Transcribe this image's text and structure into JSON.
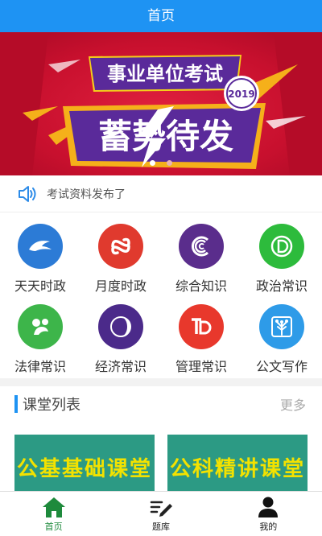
{
  "header": {
    "title": "首页"
  },
  "banner": {
    "headline": "事业单位考试",
    "slogan": "蓄势待发",
    "year": "2019",
    "slides": 2,
    "active_slide": 0
  },
  "notice": {
    "text": "考试资料发布了",
    "icon": "speaker-icon"
  },
  "categories": [
    {
      "label": "天天时政",
      "icon": "dolphin-icon",
      "color": "#2c7bd6"
    },
    {
      "label": "月度时政",
      "icon": "infinity-icon",
      "color": "#e03a2e"
    },
    {
      "label": "综合知识",
      "icon": "swirl-c-icon",
      "color": "#5a2d8c"
    },
    {
      "label": "政治常识",
      "icon": "d-letter-icon",
      "color": "#2dbb3c"
    },
    {
      "label": "法律常识",
      "icon": "leaf-icon",
      "color": "#3db54a"
    },
    {
      "label": "经济常识",
      "icon": "rings-icon",
      "color": "#4b2a8a"
    },
    {
      "label": "管理常识",
      "icon": "td-letter-icon",
      "color": "#e8382c"
    },
    {
      "label": "公文写作",
      "icon": "tree-icon",
      "color": "#2e9be8"
    }
  ],
  "section": {
    "title": "课堂列表",
    "more": "更多"
  },
  "courses": [
    {
      "title": "公基基础课堂"
    },
    {
      "title": "公科精讲课堂"
    }
  ],
  "tabbar": [
    {
      "label": "首页",
      "icon": "home-icon",
      "active": true
    },
    {
      "label": "题库",
      "icon": "pen-list-icon",
      "active": false
    },
    {
      "label": "我的",
      "icon": "user-icon",
      "active": false
    }
  ],
  "colors": {
    "primary": "#1e93f3",
    "active_tab": "#1e8a3c",
    "course_bg": "#2c9a84"
  }
}
